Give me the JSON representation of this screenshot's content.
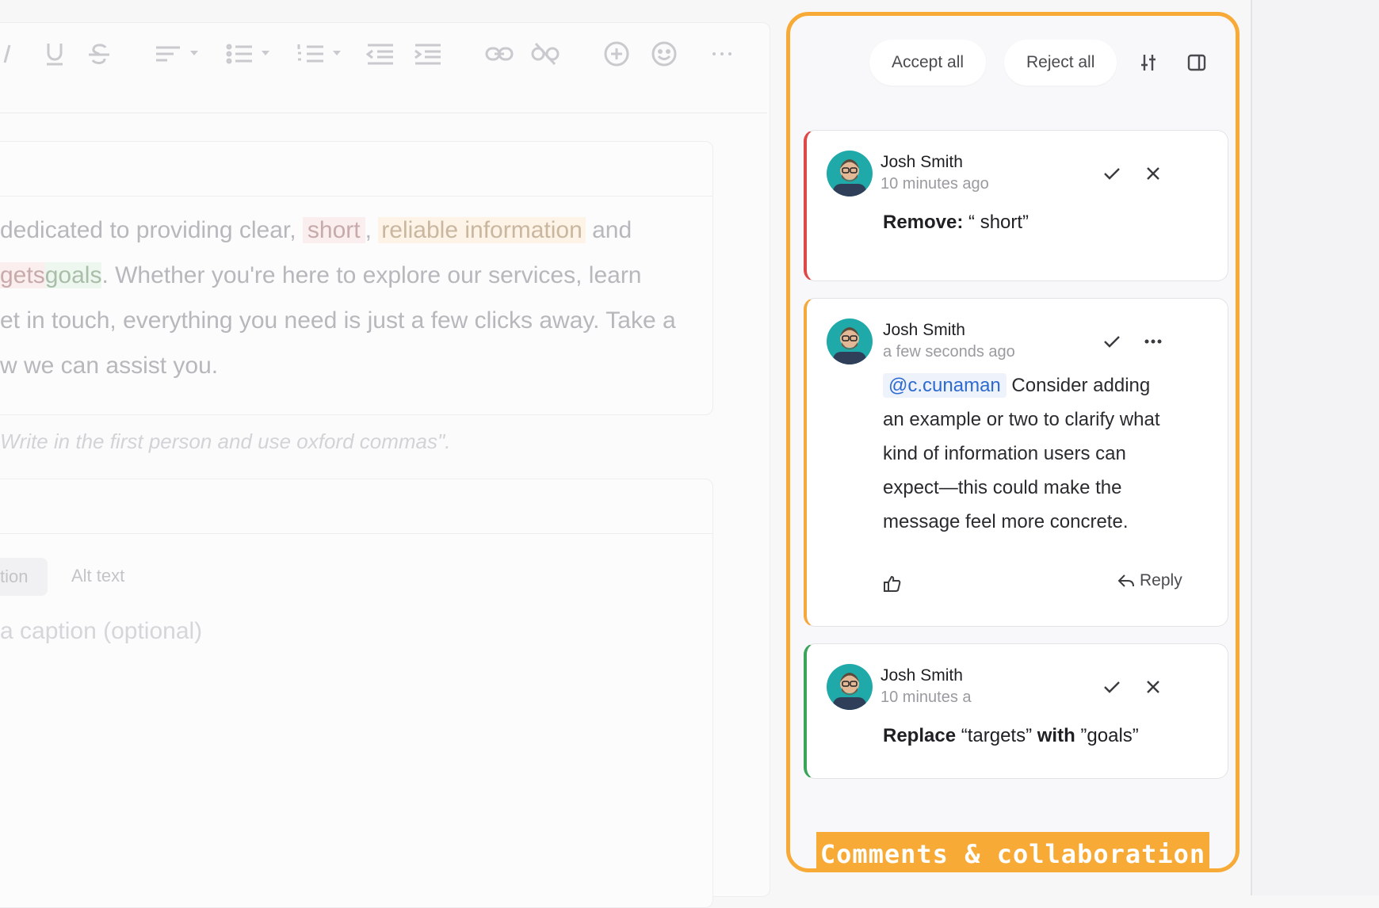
{
  "editor": {
    "paragraph_lines": [
      {
        "pre": "dedicated to providing clear, ",
        "hl1": "short",
        "mid": ", ",
        "hl2": "reliable information",
        "post": " and"
      },
      {
        "pre": "",
        "hl1": "gets",
        "mid": "",
        "hl2": "goals",
        "post": ". Whether you're here to explore our services, learn"
      },
      {
        "pre": "et in touch, everything you need is just a few clicks away. Take a",
        "hl1": "",
        "mid": "",
        "hl2": "",
        "post": ""
      },
      {
        "pre": "w we can assist you.",
        "hl1": "",
        "mid": "",
        "hl2": "",
        "post": ""
      }
    ],
    "hint": "Write in the first person and use oxford commas\".",
    "tab_caption": "tion",
    "tab_alt": "Alt text",
    "caption_placeholder": "a caption (optional)"
  },
  "panel": {
    "accept_all": "Accept all",
    "reject_all": "Reject all",
    "accent_color": "#f8aa36",
    "cards": [
      {
        "author": "Josh Smith",
        "time": "10 minutes ago",
        "label": "Remove:",
        "text": " “ short”"
      },
      {
        "author": "Josh Smith",
        "time": "a few seconds ago",
        "mention": "@c.cunaman",
        "lines": [
          " Consider adding",
          "an example or two to clarify what",
          "kind of information users can",
          "expect—this could make the",
          "message feel more concrete."
        ],
        "reply": "Reply"
      },
      {
        "author": "Josh Smith",
        "time": "10 minutes a",
        "label1": "Replace",
        "text1": " “targets” ",
        "label2": "with",
        "text2": " ”goals”"
      }
    ],
    "banner": "Comments & collaboration"
  }
}
